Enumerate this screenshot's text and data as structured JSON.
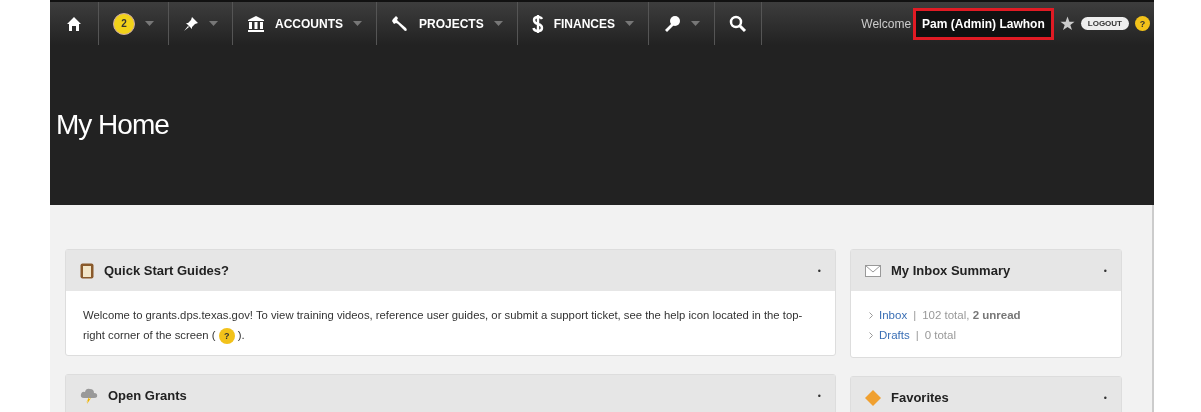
{
  "nav": {
    "items": [
      {
        "kind": "home"
      },
      {
        "kind": "badge",
        "badge": "2"
      },
      {
        "kind": "pin"
      },
      {
        "kind": "accounts",
        "label": "ACCOUNTS"
      },
      {
        "kind": "projects",
        "label": "PROJECTS"
      },
      {
        "kind": "finances",
        "label": "FINANCES"
      },
      {
        "kind": "key"
      },
      {
        "kind": "search"
      }
    ],
    "welcome": "Welcome",
    "user": "Pam (Admin) Lawhon",
    "logout": "LOGOUT",
    "help": "?"
  },
  "header": {
    "title": "My Home"
  },
  "main_panels": [
    {
      "kind": "guide",
      "title": "Quick Start Guides?",
      "toggle": "•",
      "text": "Welcome to grants.dps.texas.gov! To view training videos, reference user guides, or submit a support ticket, see the help icon located in the top-right corner of the screen (",
      "help": "?",
      "text_end": ")."
    },
    {
      "kind": "grants",
      "title": "Open Grants",
      "toggle": "•"
    }
  ],
  "side_panels": [
    {
      "kind": "inbox",
      "title": "My Inbox Summary",
      "toggle": "•",
      "links": [
        {
          "label": "Inbox",
          "sep": "|",
          "info": "102 total, **2 unread**"
        },
        {
          "label": "Drafts",
          "sep": "|",
          "info": "0 total"
        }
      ]
    },
    {
      "kind": "favorites",
      "title": "Favorites",
      "toggle": "•"
    }
  ]
}
